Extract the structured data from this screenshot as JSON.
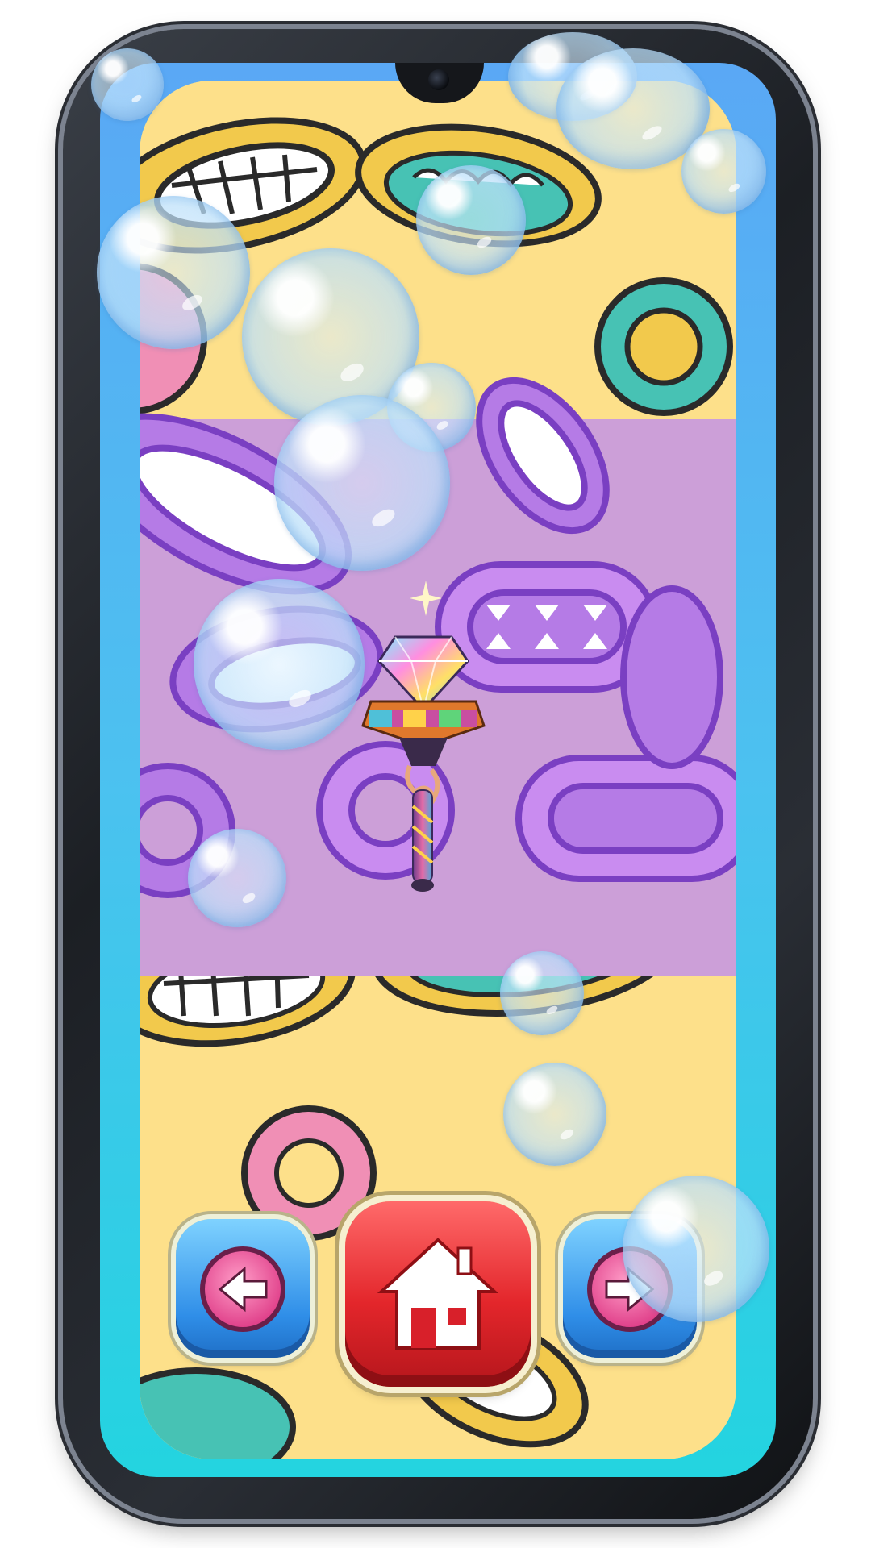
{
  "screen": "magic-wand-viewer",
  "item": {
    "icon": "rainbow-gem-wand-icon"
  },
  "controls": {
    "prev": {
      "icon": "arrow-left-icon"
    },
    "home": {
      "icon": "home-icon"
    },
    "next": {
      "icon": "arrow-right-icon"
    }
  },
  "colors": {
    "background_top": "#fde08a",
    "purple_band": "#cc9fd8",
    "screen_gradient_top": "#5aa8f5",
    "screen_gradient_bottom": "#23d4e0",
    "home_button": "#e3262b",
    "nav_button": "#2f8ee8"
  }
}
